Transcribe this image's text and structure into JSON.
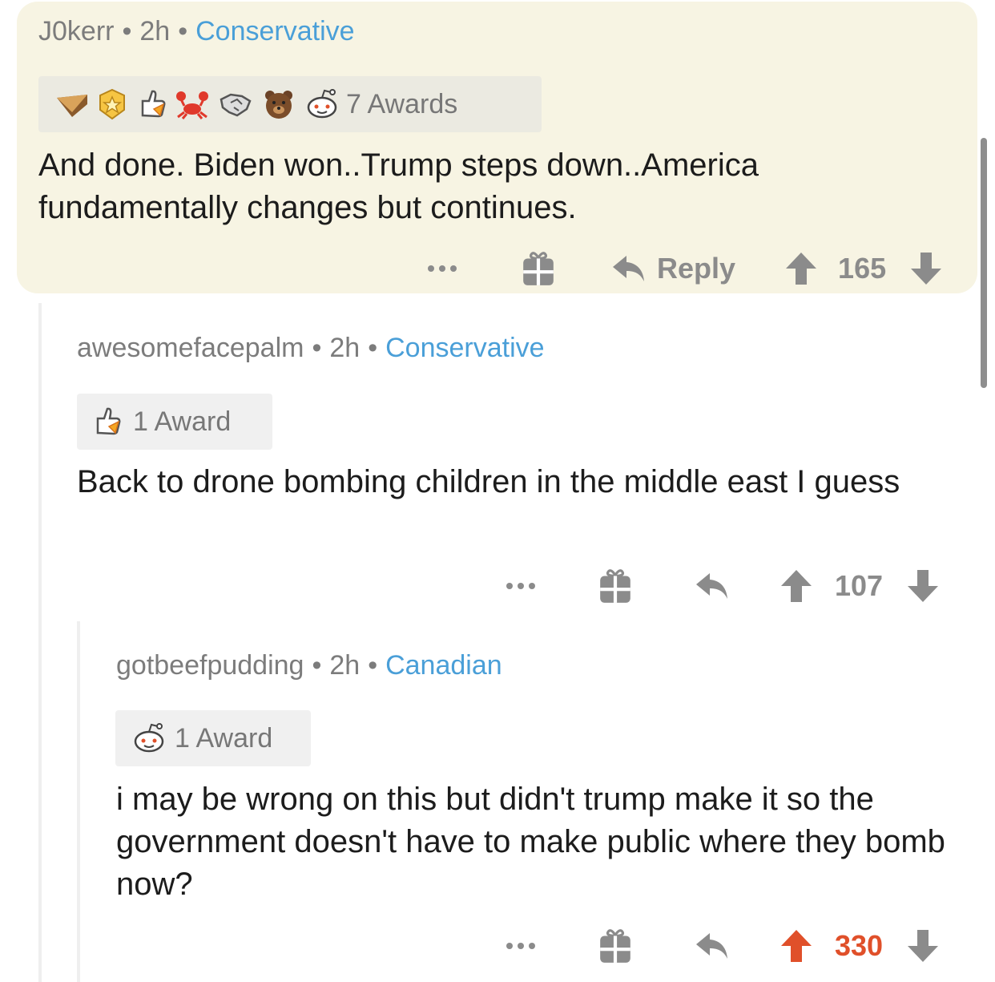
{
  "comments": [
    {
      "author": "J0kerr",
      "age": "2h",
      "flair": "Conservative",
      "awards_label": "7 Awards",
      "award_icons": [
        "pie-award-icon",
        "gold-medal-award-icon",
        "thumbs-up-rocket-award-icon",
        "crab-award-icon",
        "handshake-award-icon",
        "bear-award-icon",
        "snoo-award-icon"
      ],
      "text": "And done. Biden won..Trump steps down..America fundamentally changes but continues.",
      "reply_label": "Reply",
      "score": "165"
    },
    {
      "author": "awesomefacepalm",
      "age": "2h",
      "flair": "Conservative",
      "awards_label": "1 Award",
      "award_icons": [
        "thumbs-up-rocket-award-icon"
      ],
      "text": "Back to drone bombing children in the middle east I guess",
      "score": "107"
    },
    {
      "author": "gotbeefpudding",
      "age": "2h",
      "flair": "Canadian",
      "awards_label": "1 Award",
      "award_icons": [
        "snoo-award-icon"
      ],
      "text": "i may be wrong on this but didn't trump make it so the government doesn't have to make public where they bomb now?",
      "score": "330",
      "upvoted": true
    }
  ],
  "colors": {
    "highlight_bg": "#f7f4e3",
    "flair": "#4a9fd8",
    "upvote": "#e0502a",
    "muted": "#8b8b8b"
  }
}
